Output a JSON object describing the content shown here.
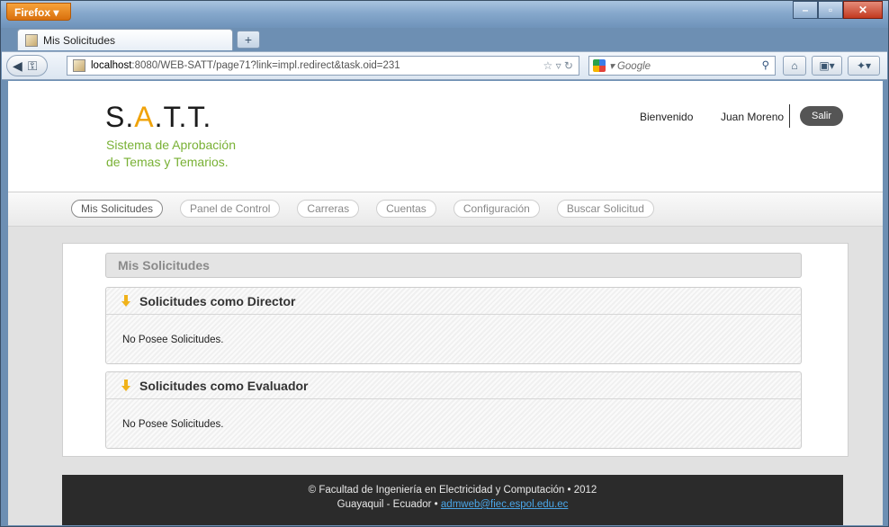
{
  "browser": {
    "menu_button": "Firefox",
    "tab_title": "Mis Solicitudes",
    "new_tab": "+",
    "url_host": "localhost",
    "url_rest": ":8080/WEB-SATT/page71?link=impl.redirect&task.oid=231",
    "search_placeholder": "Google",
    "window_controls": [
      "minimize-icon",
      "maximize-icon",
      "close-icon"
    ]
  },
  "header": {
    "logo_s": "S.",
    "logo_a": "A",
    "logo_rest": ".T.T.",
    "tagline_line1": "Sistema de Aprobación",
    "tagline_line2": "de Temas y Temarios.",
    "welcome_label": "Bienvenido",
    "user_name": "Juan Moreno",
    "logout_label": "Salir"
  },
  "menu": {
    "items": [
      {
        "label": "Mis Solicitudes",
        "active": true
      },
      {
        "label": "Panel de Control",
        "active": false
      },
      {
        "label": "Carreras",
        "active": false
      },
      {
        "label": "Cuentas",
        "active": false
      },
      {
        "label": "Configuración",
        "active": false
      },
      {
        "label": "Buscar Solicitud",
        "active": false
      }
    ]
  },
  "main": {
    "section_title": "Mis Solicitudes",
    "panels": [
      {
        "title": "Solicitudes como Director",
        "body": "No Posee Solicitudes."
      },
      {
        "title": "Solicitudes como Evaluador",
        "body": "No Posee Solicitudes."
      }
    ]
  },
  "footer": {
    "line1": "© Facultad de Ingeniería en Electricidad y Computación • 2012",
    "line2_prefix": "Guayaquil - Ecuador • ",
    "email": "admweb@fiec.espol.edu.ec"
  }
}
